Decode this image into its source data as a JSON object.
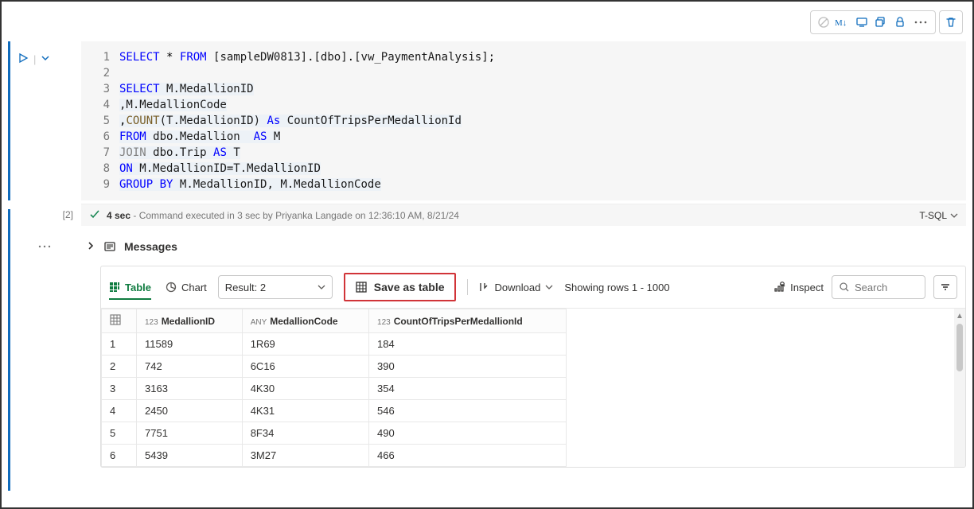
{
  "editor": {
    "lines": [
      1,
      2,
      3,
      4,
      5,
      6,
      7,
      8,
      9
    ]
  },
  "sql": {
    "l1": {
      "select": "SELECT",
      "star": "*",
      "from": "FROM",
      "t1": "[sampleDW0813]",
      "dot1": ".",
      "t2": "[dbo]",
      "dot2": ".",
      "t3": "[vw_PaymentAnalysis]",
      "semi": ";"
    },
    "l3": {
      "select": "SELECT",
      "col": "M.MedallionID"
    },
    "l4": {
      "col": ",M.MedallionCode"
    },
    "l5": {
      "comma": ",",
      "count": "COUNT",
      "arg": "(T.MedallionID)",
      "as": "As",
      "alias": "CountOfTripsPerMedallionId"
    },
    "l6": {
      "from": "FROM",
      "tbl": "dbo.Medallion",
      "as": "AS",
      "alias": "M"
    },
    "l7": {
      "join": "JOIN",
      "tbl": "dbo.Trip",
      "as": "AS",
      "alias": "T"
    },
    "l8": {
      "on": "ON",
      "cond": "M.MedallionID=T.MedallionID"
    },
    "l9": {
      "group": "GROUP",
      "by": "BY",
      "cols": "M.MedallionID, M.MedallionCode"
    }
  },
  "status": {
    "cell_index": "[2]",
    "duration": "4 sec",
    "message": "- Command executed in 3 sec by Priyanka Langade on 12:36:10 AM, 8/21/24",
    "lang": "T-SQL"
  },
  "messages": {
    "label": "Messages"
  },
  "results": {
    "view_table": "Table",
    "view_chart": "Chart",
    "result_label": "Result: 2",
    "save_as_table": "Save as table",
    "download": "Download",
    "rows_text": "Showing rows 1 - 1000",
    "inspect": "Inspect",
    "search_placeholder": "Search"
  },
  "table": {
    "columns": [
      {
        "type": "123",
        "name": "MedallionID"
      },
      {
        "type": "ANY",
        "name": "MedallionCode"
      },
      {
        "type": "123",
        "name": "CountOfTripsPerMedallionId"
      }
    ],
    "rows": [
      {
        "idx": "1",
        "c0": "11589",
        "c1": "1R69",
        "c2": "184"
      },
      {
        "idx": "2",
        "c0": "742",
        "c1": "6C16",
        "c2": "390"
      },
      {
        "idx": "3",
        "c0": "3163",
        "c1": "4K30",
        "c2": "354"
      },
      {
        "idx": "4",
        "c0": "2450",
        "c1": "4K31",
        "c2": "546"
      },
      {
        "idx": "5",
        "c0": "7751",
        "c1": "8F34",
        "c2": "490"
      },
      {
        "idx": "6",
        "c0": "5439",
        "c1": "3M27",
        "c2": "466"
      }
    ]
  }
}
